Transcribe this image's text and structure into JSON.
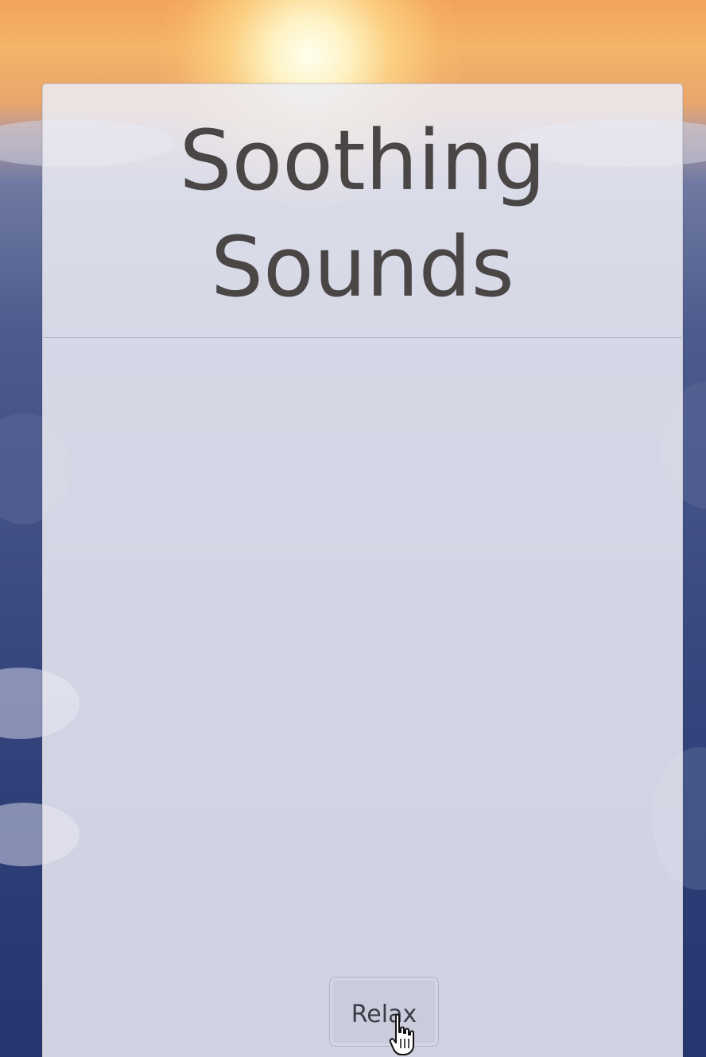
{
  "app": {
    "title": "Soothing Sounds"
  },
  "header": {
    "title": "Soothing Sounds"
  },
  "controls": {
    "relax_label": "Relax"
  },
  "icons": {
    "cursor": "hand-pointer-icon"
  },
  "colors": {
    "title_text": "#4a4646",
    "card_background": "#ececf4",
    "sky_top": "#f1a35a",
    "sky_bottom": "#26356d"
  }
}
